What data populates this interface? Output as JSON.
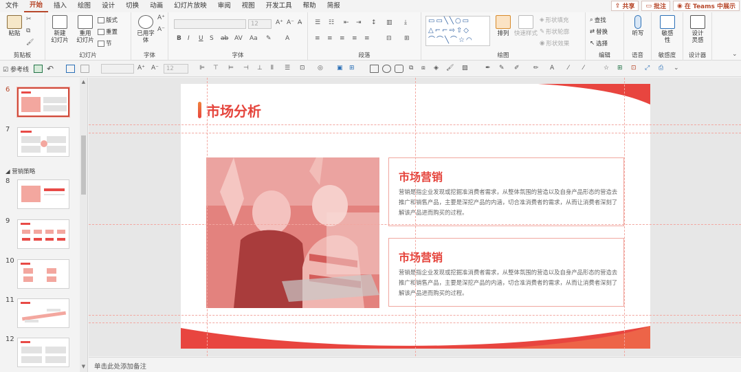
{
  "menu": {
    "items": [
      "文件",
      "开始",
      "插入",
      "绘图",
      "设计",
      "切换",
      "动画",
      "幻灯片放映",
      "审阅",
      "视图",
      "开发工具",
      "帮助",
      "简报"
    ],
    "active_index": 1,
    "share": "共享",
    "comment": "批注",
    "teams": "在 Teams 中展示"
  },
  "ribbon": {
    "clipboard": {
      "label": "剪贴板",
      "paste": "粘贴"
    },
    "slides": {
      "label": "幻灯片",
      "new_slide": "新建\n幻灯片",
      "reuse_slide": "重用\n幻灯片",
      "layout": "版式",
      "reset": "重置",
      "section": "节"
    },
    "font_group": {
      "label": "字体",
      "font_btn": "已用字\n体",
      "size": "12"
    },
    "font": {
      "label": "字体",
      "size": "12"
    },
    "paragraph": {
      "label": "段落"
    },
    "drawing": {
      "label": "绘图",
      "arrange": "排列",
      "quick_styles": "快速样式",
      "fill": "形状填充",
      "outline": "形状轮廓",
      "effect": "形状效果"
    },
    "editing": {
      "label": "编辑",
      "find": "查找",
      "replace": "替换",
      "select": "选择"
    },
    "voice": {
      "label": "语音",
      "dictate": "听写"
    },
    "sensitivity": {
      "label": "敏感度",
      "btn": "敏感\n性"
    },
    "designer": {
      "label": "设计器",
      "btn": "设计\n灵感"
    }
  },
  "qat": {
    "label": "参考线",
    "font_size": "12"
  },
  "thumbnails": {
    "section_name": "营销策略",
    "slides": [
      {
        "num": "6",
        "selected": true
      },
      {
        "num": "7",
        "selected": false
      },
      {
        "num": "8",
        "selected": false
      },
      {
        "num": "9",
        "selected": false
      },
      {
        "num": "10",
        "selected": false
      },
      {
        "num": "11",
        "selected": false
      },
      {
        "num": "12",
        "selected": false
      }
    ]
  },
  "slide": {
    "title": "市场分析",
    "cards": [
      {
        "title": "市场营销",
        "body": "营销是指企业发现或挖掘准消费者需求，从整体氛围的营造以及自身产品形态的营造去推广和销售产品，主要是深挖产品的内涵，切合准消费者的需求，从而让消费者深刻了解该产品进而购买的过程。"
      },
      {
        "title": "市场营销",
        "body": "营销是指企业发现或挖掘准消费者需求，从整体氛围的营造以及自身产品形态的营造去推广和销售产品，主要是深挖产品的内涵，切合准消费者的需求，从而让消费者深刻了解该产品进而购买的过程。"
      }
    ]
  },
  "notes_placeholder": "单击此处添加备注",
  "colors": {
    "accent": "#e5443c",
    "ribbon_active": "#b7472a",
    "photo_tint": "#e06f6c"
  }
}
